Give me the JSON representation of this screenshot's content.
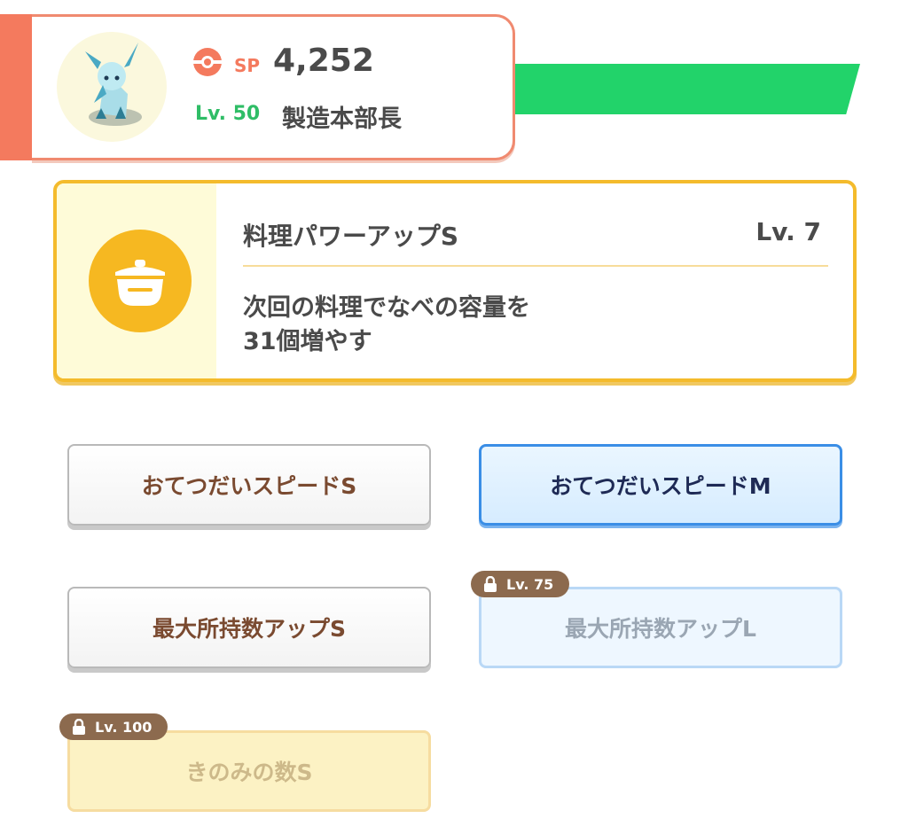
{
  "header": {
    "sp_label": "SP",
    "sp_value": "4,252",
    "level": "Lv. 50",
    "title": "製造本部長",
    "accent_color": "#f47a5e",
    "bar_color": "#22d36a"
  },
  "skill": {
    "name": "料理パワーアップS",
    "level": "Lv. 7",
    "desc_line1": "次回の料理でなべの容量を",
    "desc_line2": "31個増やす",
    "icon": "pot-icon"
  },
  "options": [
    {
      "label": "おてつだいスピードS",
      "state": "normal"
    },
    {
      "label": "おてつだいスピードM",
      "state": "selected"
    },
    {
      "label": "最大所持数アップS",
      "state": "normal"
    },
    {
      "label": "最大所持数アップL",
      "state": "locked",
      "lock_level": "Lv. 75"
    },
    {
      "label": "きのみの数S",
      "state": "locked",
      "lock_level": "Lv. 100"
    }
  ]
}
